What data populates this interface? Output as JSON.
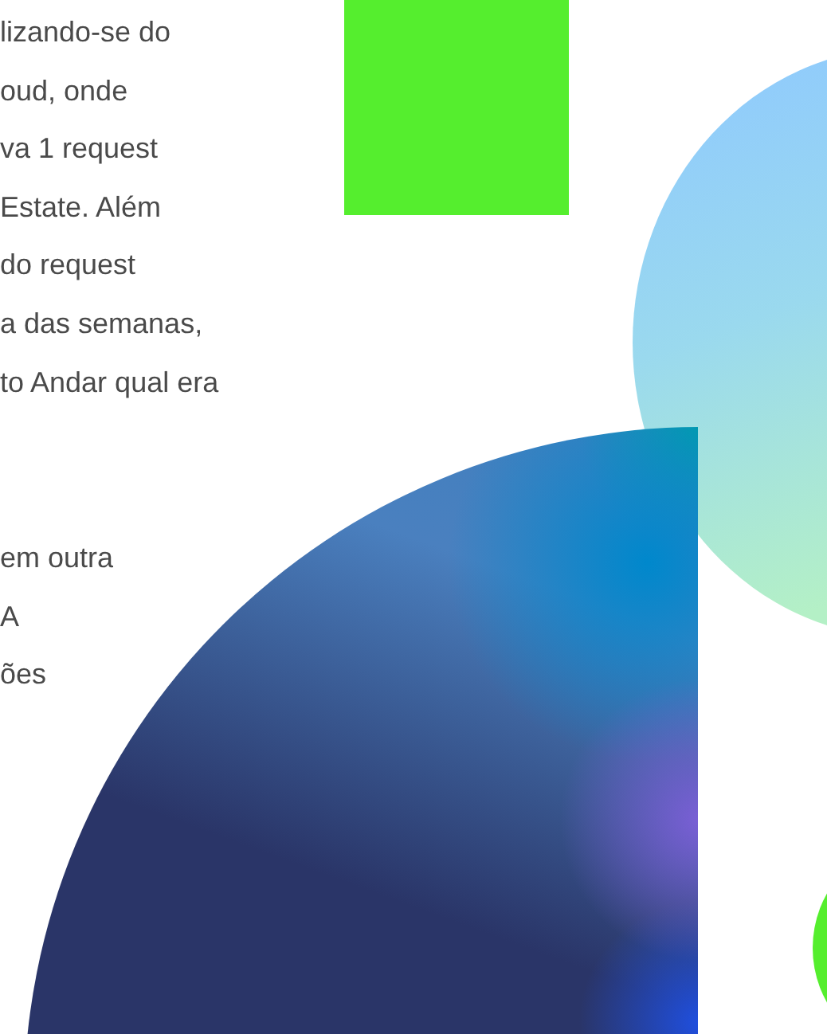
{
  "paragraphs": [
    {
      "lines": [
        "lizando-se do",
        "oud, onde",
        "va 1 request",
        "Estate. Além",
        "do request",
        "a das semanas,",
        "to Andar qual era"
      ]
    },
    {
      "lines": [
        "em outra",
        "A",
        "ões"
      ]
    }
  ]
}
